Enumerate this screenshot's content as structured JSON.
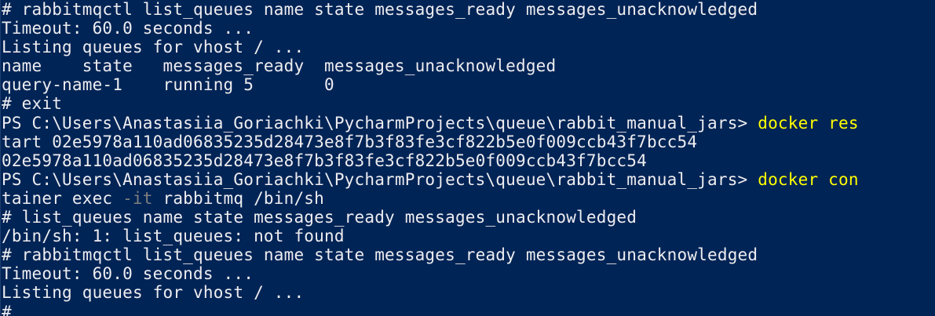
{
  "window": {
    "type": "powershell-console",
    "background_color": "#012456",
    "text_color": "#EEEDF0",
    "command_color": "#FFFF00",
    "parameter_color": "#7F7F7F"
  },
  "lines": [
    {
      "segments": [
        {
          "text": "# rabbitmqctl list_queues name state messages_ready messages_unacknowledged"
        }
      ]
    },
    {
      "segments": [
        {
          "text": "Timeout: 60.0 seconds ..."
        }
      ]
    },
    {
      "segments": [
        {
          "text": "Listing queues for vhost / ..."
        }
      ]
    },
    {
      "segments": [
        {
          "text": "name    state   messages_ready  messages_unacknowledged"
        }
      ]
    },
    {
      "segments": [
        {
          "text": "query-name-1    running 5       0"
        }
      ]
    },
    {
      "segments": [
        {
          "text": "# exit"
        }
      ]
    },
    {
      "segments": [
        {
          "text": "PS C:\\Users\\Anastasiia_Goriachki\\PycharmProjects\\queue\\rabbit_manual_jars> "
        },
        {
          "text": "docker res",
          "style": "cmd"
        }
      ]
    },
    {
      "segments": [
        {
          "text": "tart 02e5978a110ad06835235d28473e8f7b3f83fe3cf822b5e0f009ccb43f7bcc54"
        }
      ]
    },
    {
      "segments": [
        {
          "text": "02e5978a110ad06835235d28473e8f7b3f83fe3cf822b5e0f009ccb43f7bcc54"
        }
      ]
    },
    {
      "segments": [
        {
          "text": "PS C:\\Users\\Anastasiia_Goriachki\\PycharmProjects\\queue\\rabbit_manual_jars> "
        },
        {
          "text": "docker con",
          "style": "cmd"
        }
      ]
    },
    {
      "segments": [
        {
          "text": "tainer exec "
        },
        {
          "text": "-it",
          "style": "param"
        },
        {
          "text": " rabbitmq /bin/sh"
        }
      ]
    },
    {
      "segments": [
        {
          "text": "# list_queues name state messages_ready messages_unacknowledged"
        }
      ]
    },
    {
      "segments": [
        {
          "text": "/bin/sh: 1: list_queues: not found"
        }
      ]
    },
    {
      "segments": [
        {
          "text": "# rabbitmqctl list_queues name state messages_ready messages_unacknowledged"
        }
      ]
    },
    {
      "segments": [
        {
          "text": "Timeout: 60.0 seconds ..."
        }
      ]
    },
    {
      "segments": [
        {
          "text": "Listing queues for vhost / ..."
        }
      ]
    },
    {
      "segments": [
        {
          "text": "#"
        }
      ]
    }
  ]
}
